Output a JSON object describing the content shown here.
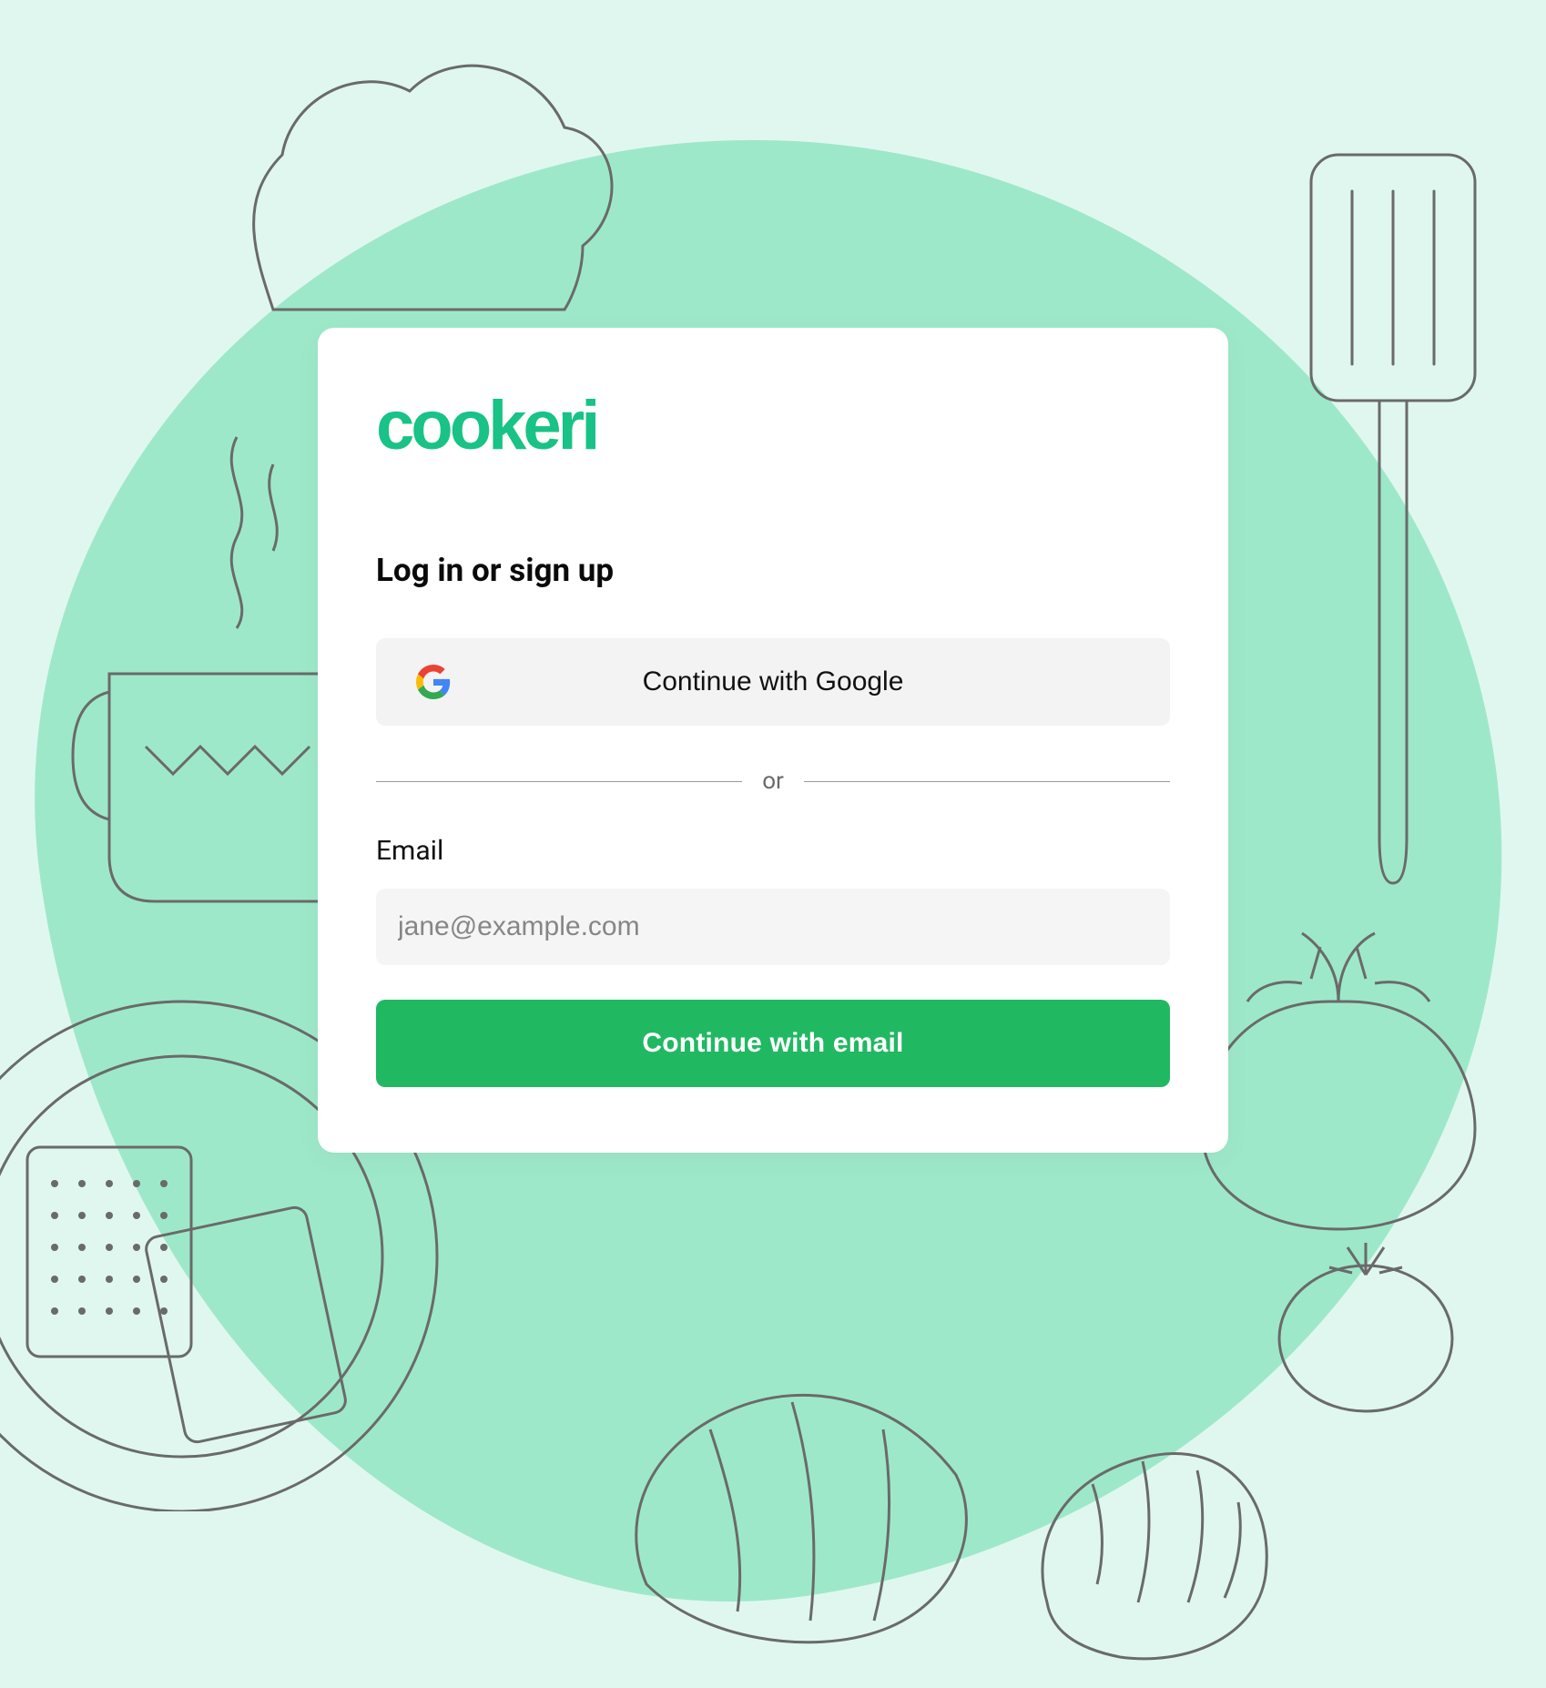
{
  "brand": {
    "name": "cookeri"
  },
  "auth": {
    "heading": "Log in or sign up",
    "google_label": "Continue with Google",
    "divider_label": "or",
    "email_label": "Email",
    "email_placeholder": "jane@example.com",
    "continue_email_label": "Continue with email"
  },
  "colors": {
    "brand_green": "#19c287",
    "cta_green": "#21b862",
    "bg_light": "#e0f7ef",
    "bg_blob": "#9ee8ca"
  }
}
